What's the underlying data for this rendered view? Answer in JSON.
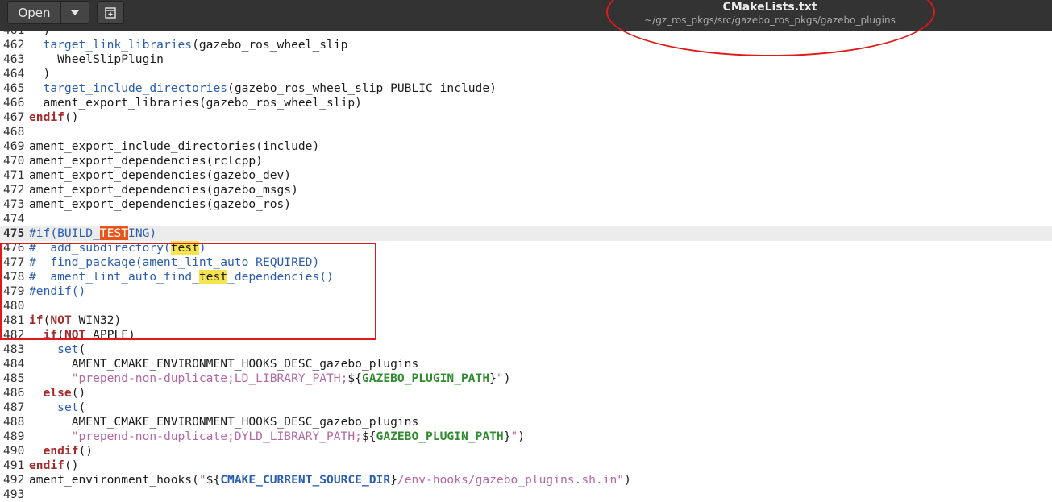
{
  "toolbar": {
    "open_label": "Open",
    "dropdown_icon": "chevron-down-icon",
    "new_tab_icon": "new-document-icon"
  },
  "window": {
    "title": "CMakeLists.txt",
    "path": "~/gz_ros_pkgs/src/gazebo_ros_pkgs/gazebo_plugins"
  },
  "colors": {
    "annotation_red": "#e01a1a",
    "current_match": "#e8551b",
    "other_match": "#f5e44e"
  },
  "editor": {
    "current_line": "475",
    "search_term": "test",
    "lines": [
      {
        "num": "461",
        "segs": [
          {
            "t": "  )",
            "c": ""
          }
        ]
      },
      {
        "num": "462",
        "segs": [
          {
            "t": "  ",
            "c": ""
          },
          {
            "t": "target_link_libraries",
            "c": "fn"
          },
          {
            "t": "(gazebo_ros_wheel_slip",
            "c": ""
          }
        ]
      },
      {
        "num": "463",
        "segs": [
          {
            "t": "    WheelSlipPlugin",
            "c": ""
          }
        ]
      },
      {
        "num": "464",
        "segs": [
          {
            "t": "  )",
            "c": ""
          }
        ]
      },
      {
        "num": "465",
        "segs": [
          {
            "t": "  ",
            "c": ""
          },
          {
            "t": "target_include_directories",
            "c": "fn"
          },
          {
            "t": "(gazebo_ros_wheel_slip PUBLIC include)",
            "c": ""
          }
        ]
      },
      {
        "num": "466",
        "segs": [
          {
            "t": "  ament_export_libraries(gazebo_ros_wheel_slip)",
            "c": ""
          }
        ]
      },
      {
        "num": "467",
        "segs": [
          {
            "t": "endif",
            "c": "kw"
          },
          {
            "t": "()",
            "c": ""
          }
        ]
      },
      {
        "num": "468",
        "segs": []
      },
      {
        "num": "469",
        "segs": [
          {
            "t": "ament_export_include_directories(include)",
            "c": ""
          }
        ]
      },
      {
        "num": "470",
        "segs": [
          {
            "t": "ament_export_dependencies(rclcpp)",
            "c": ""
          }
        ]
      },
      {
        "num": "471",
        "segs": [
          {
            "t": "ament_export_dependencies(gazebo_dev)",
            "c": ""
          }
        ]
      },
      {
        "num": "472",
        "segs": [
          {
            "t": "ament_export_dependencies(gazebo_msgs)",
            "c": ""
          }
        ]
      },
      {
        "num": "473",
        "segs": [
          {
            "t": "ament_export_dependencies(gazebo_ros)",
            "c": ""
          }
        ]
      },
      {
        "num": "474",
        "segs": []
      },
      {
        "num": "475",
        "current": true,
        "segs": [
          {
            "t": "#if(BUILD_",
            "c": "cm"
          },
          {
            "t": "TEST",
            "c": "hlcur"
          },
          {
            "t": "ING)",
            "c": "cm"
          }
        ]
      },
      {
        "num": "476",
        "segs": [
          {
            "t": "#  add_subdirectory(",
            "c": "cm"
          },
          {
            "t": "test",
            "c": "hlmatch"
          },
          {
            "t": ")",
            "c": "cm"
          }
        ]
      },
      {
        "num": "477",
        "segs": [
          {
            "t": "#  find_package(ament_lint_auto REQUIRED)",
            "c": "cm"
          }
        ]
      },
      {
        "num": "478",
        "segs": [
          {
            "t": "#  ament_lint_auto_find_",
            "c": "cm"
          },
          {
            "t": "test",
            "c": "hlmatch"
          },
          {
            "t": "_dependencies()",
            "c": "cm"
          }
        ]
      },
      {
        "num": "479",
        "segs": [
          {
            "t": "#endif()",
            "c": "cm"
          }
        ]
      },
      {
        "num": "480",
        "segs": []
      },
      {
        "num": "481",
        "segs": [
          {
            "t": "if",
            "c": "kw"
          },
          {
            "t": "(",
            "c": ""
          },
          {
            "t": "NOT",
            "c": "kw"
          },
          {
            "t": " WIN32)",
            "c": ""
          }
        ]
      },
      {
        "num": "482",
        "segs": [
          {
            "t": "  ",
            "c": ""
          },
          {
            "t": "if",
            "c": "kw"
          },
          {
            "t": "(",
            "c": ""
          },
          {
            "t": "NOT",
            "c": "kw"
          },
          {
            "t": " APPLE)",
            "c": ""
          }
        ]
      },
      {
        "num": "483",
        "segs": [
          {
            "t": "    ",
            "c": ""
          },
          {
            "t": "set",
            "c": "fn"
          },
          {
            "t": "(",
            "c": ""
          }
        ]
      },
      {
        "num": "484",
        "segs": [
          {
            "t": "      AMENT_CMAKE_ENVIRONMENT_HOOKS_DESC_gazebo_plugins",
            "c": ""
          }
        ]
      },
      {
        "num": "485",
        "segs": [
          {
            "t": "      ",
            "c": ""
          },
          {
            "t": "\"prepend-non-duplicate;LD_LIBRARY_PATH;",
            "c": "str"
          },
          {
            "t": "${",
            "c": ""
          },
          {
            "t": "GAZEBO_PLUGIN_PATH",
            "c": "var"
          },
          {
            "t": "}",
            "c": ""
          },
          {
            "t": "\"",
            "c": "str"
          },
          {
            "t": ")",
            "c": ""
          }
        ]
      },
      {
        "num": "486",
        "segs": [
          {
            "t": "  ",
            "c": ""
          },
          {
            "t": "else",
            "c": "kw"
          },
          {
            "t": "()",
            "c": ""
          }
        ]
      },
      {
        "num": "487",
        "segs": [
          {
            "t": "    ",
            "c": ""
          },
          {
            "t": "set",
            "c": "fn"
          },
          {
            "t": "(",
            "c": ""
          }
        ]
      },
      {
        "num": "488",
        "segs": [
          {
            "t": "      AMENT_CMAKE_ENVIRONMENT_HOOKS_DESC_gazebo_plugins",
            "c": ""
          }
        ]
      },
      {
        "num": "489",
        "segs": [
          {
            "t": "      ",
            "c": ""
          },
          {
            "t": "\"prepend-non-duplicate;DYLD_LIBRARY_PATH;",
            "c": "str"
          },
          {
            "t": "${",
            "c": ""
          },
          {
            "t": "GAZEBO_PLUGIN_PATH",
            "c": "var"
          },
          {
            "t": "}",
            "c": ""
          },
          {
            "t": "\"",
            "c": "str"
          },
          {
            "t": ")",
            "c": ""
          }
        ]
      },
      {
        "num": "490",
        "segs": [
          {
            "t": "  ",
            "c": ""
          },
          {
            "t": "endif",
            "c": "kw"
          },
          {
            "t": "()",
            "c": ""
          }
        ]
      },
      {
        "num": "491",
        "segs": [
          {
            "t": "endif",
            "c": "kw"
          },
          {
            "t": "()",
            "c": ""
          }
        ]
      },
      {
        "num": "492",
        "segs": [
          {
            "t": "ament_environment_hooks(",
            "c": ""
          },
          {
            "t": "\"",
            "c": "str"
          },
          {
            "t": "${",
            "c": ""
          },
          {
            "t": "CMAKE_CURRENT_SOURCE_DIR",
            "c": "var2"
          },
          {
            "t": "}",
            "c": ""
          },
          {
            "t": "/env-hooks/gazebo_plugins.sh.in\"",
            "c": "str"
          },
          {
            "t": ")",
            "c": ""
          }
        ]
      },
      {
        "num": "493",
        "segs": []
      }
    ]
  }
}
